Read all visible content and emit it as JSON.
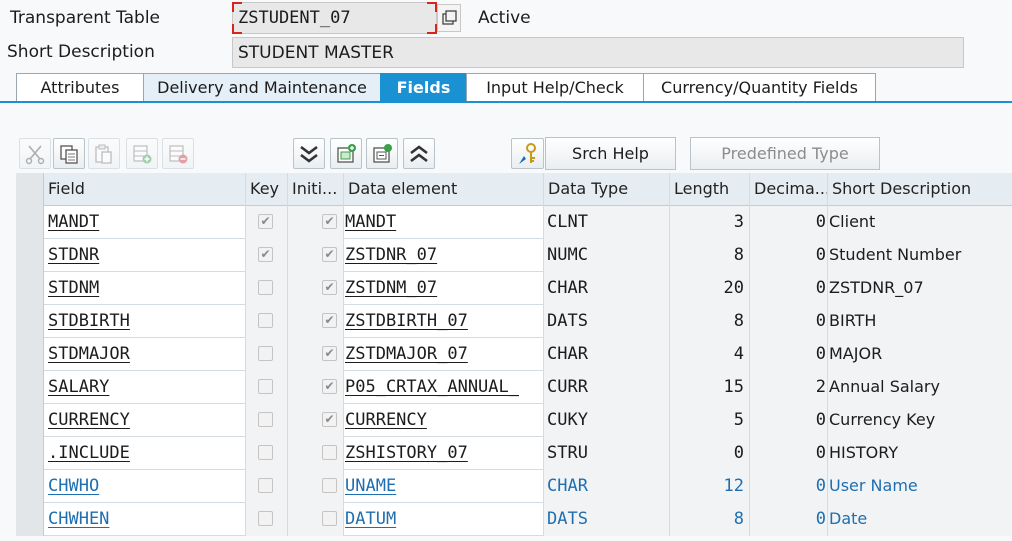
{
  "header": {
    "type_label": "Transparent Table",
    "table_name": "ZSTUDENT_07",
    "status": "Active",
    "short_desc_label": "Short Description",
    "short_desc_value": "STUDENT MASTER"
  },
  "tabs": [
    {
      "label": "Attributes",
      "state": "normal"
    },
    {
      "label": "Delivery and Maintenance",
      "state": "alt"
    },
    {
      "label": "Fields",
      "state": "active"
    },
    {
      "label": "Input Help/Check",
      "state": "normal"
    },
    {
      "label": "Currency/Quantity Fields",
      "state": "normal"
    }
  ],
  "toolbar": {
    "icons": [
      "cut-icon",
      "copy-icon",
      "paste-icon",
      "insert-row-icon",
      "delete-row-icon",
      "expand-all-icon",
      "new-entry-icon",
      "detail-icon",
      "collapse-all-icon",
      "key-icon"
    ],
    "srch_help_label": "Srch Help",
    "predefined_type_label": "Predefined Type"
  },
  "grid": {
    "columns": [
      "Field",
      "Key",
      "Initi...",
      "Data element",
      "Data Type",
      "Length",
      "Decima...",
      "Short Description"
    ],
    "rows": [
      {
        "field": "MANDT",
        "key": true,
        "initial": true,
        "data_element": "MANDT",
        "data_type": "CLNT",
        "length": "3",
        "decimals": "0",
        "description": "Client",
        "style": "normal"
      },
      {
        "field": "STDNR",
        "key": true,
        "initial": true,
        "data_element": "ZSTDNR_07",
        "data_type": "NUMC",
        "length": "8",
        "decimals": "0",
        "description": "Student Number",
        "style": "normal"
      },
      {
        "field": "STDNM",
        "key": false,
        "initial": true,
        "data_element": "ZSTDNM_07",
        "data_type": "CHAR",
        "length": "20",
        "decimals": "0",
        "description": "ZSTDNR_07",
        "style": "normal"
      },
      {
        "field": "STDBIRTH",
        "key": false,
        "initial": true,
        "data_element": "ZSTDBIRTH_07",
        "data_type": "DATS",
        "length": "8",
        "decimals": "0",
        "description": "BIRTH",
        "style": "normal"
      },
      {
        "field": "STDMAJOR",
        "key": false,
        "initial": true,
        "data_element": "ZSTDMAJOR_07",
        "data_type": "CHAR",
        "length": "4",
        "decimals": "0",
        "description": "MAJOR",
        "style": "normal"
      },
      {
        "field": "SALARY",
        "key": false,
        "initial": true,
        "data_element": "P05_CRTAX_ANNUAL_",
        "data_type": "CURR",
        "length": "15",
        "decimals": "2",
        "description": "Annual Salary",
        "style": "normal"
      },
      {
        "field": "CURRENCY",
        "key": false,
        "initial": true,
        "data_element": "CURRENCY",
        "data_type": "CUKY",
        "length": "5",
        "decimals": "0",
        "description": "Currency Key",
        "style": "normal"
      },
      {
        "field": ".INCLUDE",
        "key": false,
        "initial": false,
        "data_element": "ZSHISTORY_07",
        "data_type": "STRU",
        "length": "0",
        "decimals": "0",
        "description": "HISTORY",
        "style": "normal"
      },
      {
        "field": "CHWHO",
        "key": false,
        "initial": false,
        "data_element": "UNAME",
        "data_type": "CHAR",
        "length": "12",
        "decimals": "0",
        "description": "User Name",
        "style": "include"
      },
      {
        "field": "CHWHEN",
        "key": false,
        "initial": false,
        "data_element": "DATUM",
        "data_type": "DATS",
        "length": "8",
        "decimals": "0",
        "description": "Date",
        "style": "include"
      }
    ]
  },
  "colors": {
    "accent": "#1a91d3",
    "include_text": "#1f6fb0",
    "focus_corner": "#d9241b"
  }
}
